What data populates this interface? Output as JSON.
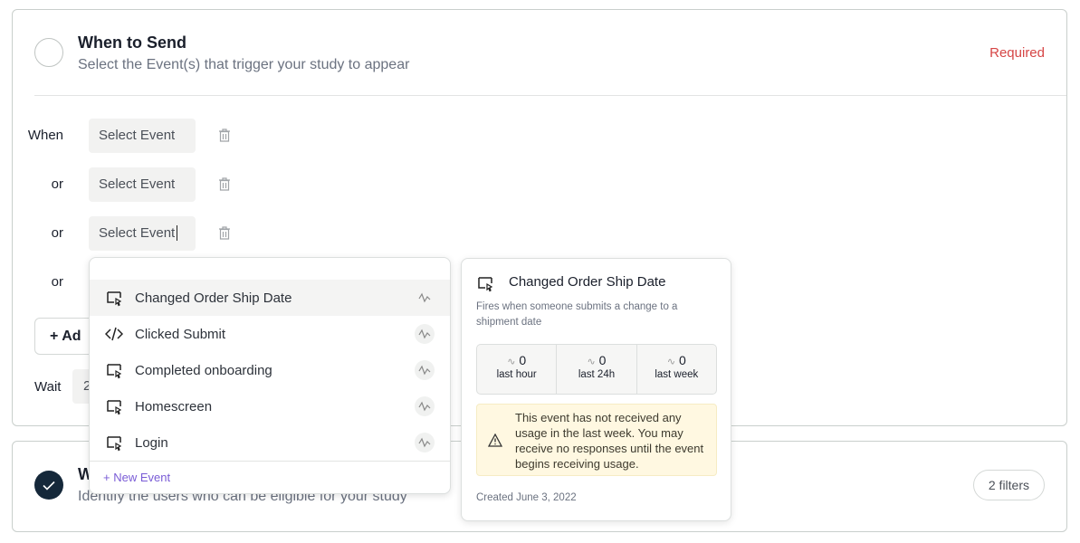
{
  "when_card": {
    "title": "When to Send",
    "subtitle": "Select the Event(s) that trigger your study to appear",
    "required": "Required",
    "rows": [
      {
        "label": "When",
        "value": "Select Event"
      },
      {
        "label": "or",
        "value": "Select Event"
      },
      {
        "label": "or",
        "value": "Select Event"
      },
      {
        "label": "or",
        "value": ""
      }
    ],
    "add_label": "Ad",
    "wait_label": "Wait",
    "wait_value": "2"
  },
  "who_card": {
    "title": "W",
    "subtitle": "Identify the users who can be eligible for your study",
    "filters": "2 filters"
  },
  "dropdown": {
    "items": [
      {
        "label": "Changed Order Ship Date",
        "icon": "event-cursor-icon"
      },
      {
        "label": "Clicked Submit",
        "icon": "code-icon"
      },
      {
        "label": "Completed onboarding",
        "icon": "event-cursor-icon"
      },
      {
        "label": "Homescreen",
        "icon": "event-cursor-icon"
      },
      {
        "label": "Login",
        "icon": "event-cursor-icon"
      }
    ],
    "new_event": "+ New Event"
  },
  "tooltip": {
    "title": "Changed Order Ship Date",
    "description": "Fires when someone submits a change to a shipment date",
    "stats": [
      {
        "value": "0",
        "label": "last hour"
      },
      {
        "value": "0",
        "label": "last 24h"
      },
      {
        "value": "0",
        "label": "last week"
      }
    ],
    "warning": "This event has not received any usage in the last week. You may receive no responses until the event begins receiving usage.",
    "created": "Created June 3, 2022"
  },
  "colors": {
    "required": "#d64545",
    "accent": "#7a5cd6",
    "check": "#15283a",
    "warning_bg": "#fff8e1"
  }
}
